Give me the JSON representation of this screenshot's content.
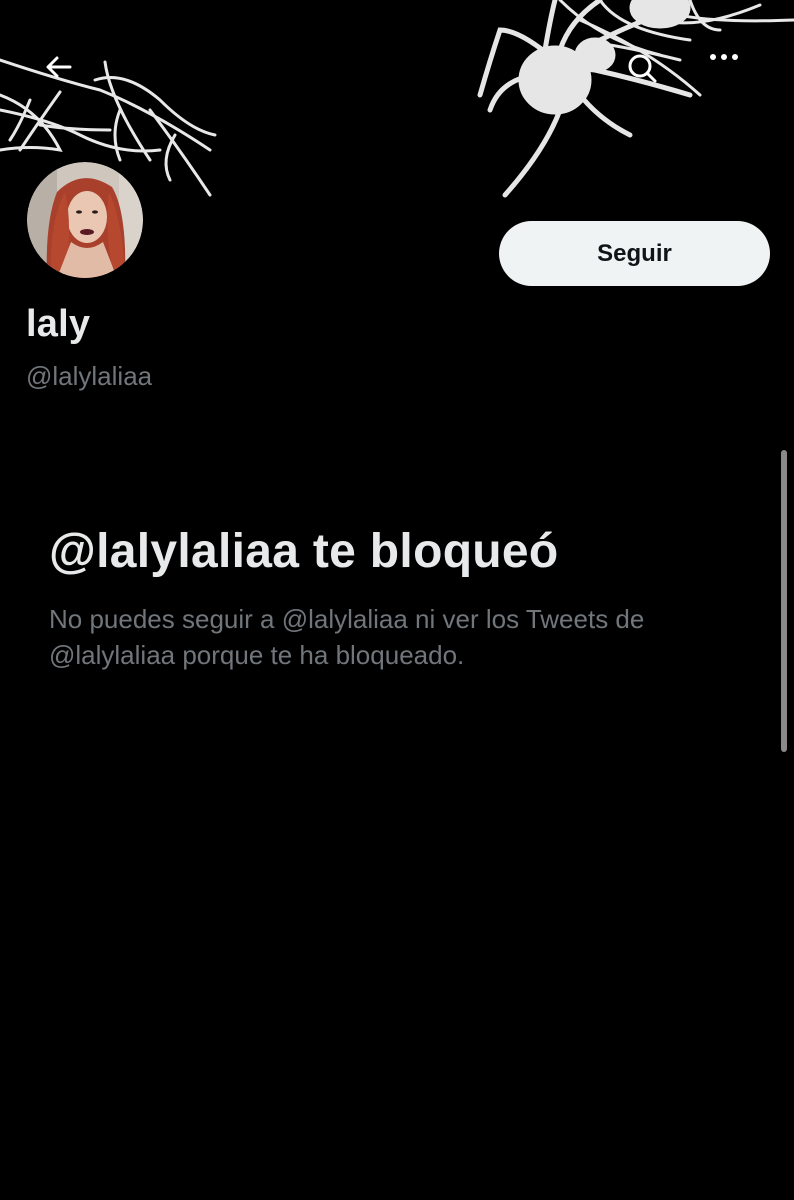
{
  "header": {
    "back_icon": "arrow-left-icon",
    "search_icon": "search-icon",
    "more_icon": "more-horizontal-icon",
    "banner": "spider-web-banner"
  },
  "profile": {
    "display_name": "laly",
    "handle": "@lalylaliaa",
    "follow_label": "Seguir"
  },
  "blocked": {
    "title": "@lalylaliaa te bloqueó",
    "description": "No puedes seguir a @lalylaliaa ni ver los Tweets de @lalylaliaa porque te ha bloqueado."
  },
  "colors": {
    "background": "#000000",
    "primary_text": "#e7e9ea",
    "secondary_text": "#71767b",
    "button_bg": "#eff3f4",
    "button_text": "#0f1419"
  }
}
